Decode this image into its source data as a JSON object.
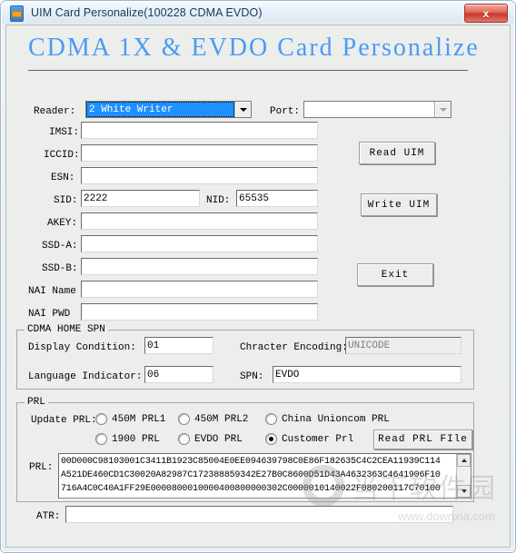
{
  "window": {
    "title": "UIM Card Personalize(100228 CDMA EVDO)",
    "close_label": "x",
    "heading": "CDMA 1X & EVDO Card Personalize"
  },
  "toolbar": {
    "reader_label": "Reader:",
    "reader_value": "2 White Writer",
    "port_label": "Port:",
    "port_value": ""
  },
  "fields": [
    {
      "label": "IMSI:",
      "value": ""
    },
    {
      "label": "ICCID:",
      "value": ""
    },
    {
      "label": "ESN:",
      "value": ""
    },
    {
      "label": "SID:",
      "value": "2222"
    },
    {
      "label": "AKEY:",
      "value": ""
    },
    {
      "label": "SSD-A:",
      "value": ""
    },
    {
      "label": "SSD-B:",
      "value": ""
    },
    {
      "label": "NAI Name",
      "value": ""
    },
    {
      "label": "NAI PWD",
      "value": ""
    }
  ],
  "nid": {
    "label": "NID:",
    "value": "65535"
  },
  "buttons": {
    "read_uim": "Read UIM",
    "write_uim": "Write UIM",
    "exit": "Exit"
  },
  "spn_group": {
    "title": "CDMA HOME SPN",
    "display_condition_label": "Display Condition:",
    "display_condition_value": "01",
    "character_encoding_label": "Chracter Encoding:",
    "character_encoding_value": "UNICODE",
    "language_indicator_label": "Language Indicator:",
    "language_indicator_value": "06",
    "spn_label": "SPN:",
    "spn_value": "EVDO"
  },
  "prl_group": {
    "title": "PRL",
    "update_label": "Update PRL:",
    "options": [
      {
        "label": "450M PRL1",
        "checked": false
      },
      {
        "label": "450M PRL2",
        "checked": false
      },
      {
        "label": "China Unioncom PRL",
        "checked": false
      },
      {
        "label": "1900 PRL",
        "checked": false
      },
      {
        "label": "EVDO PRL",
        "checked": false
      },
      {
        "label": "Customer Prl",
        "checked": true
      }
    ],
    "read_prl_file": "Read PRL FIle",
    "prl_label": "PRL:",
    "prl_text": "00D000C98103001C3411B1923C85004E0EE094639798C0E86F182635C4C2CEA11939C114\nA521DE460CD1C30020A82987C172388859342E27B0C8600D51D43A4632363C4641906F10\n716A4C0C40A1FF29E0000800010000400800000302C0000010140022F080200117C70100"
  },
  "atr": {
    "label": "ATR:",
    "value": ""
  },
  "watermark": {
    "cn": "当下软件园",
    "url": "www.downxia.com"
  },
  "colors": {
    "heading": "#4a9bf5",
    "select_highlight": "#1e90ff",
    "close": "#c8392c"
  }
}
